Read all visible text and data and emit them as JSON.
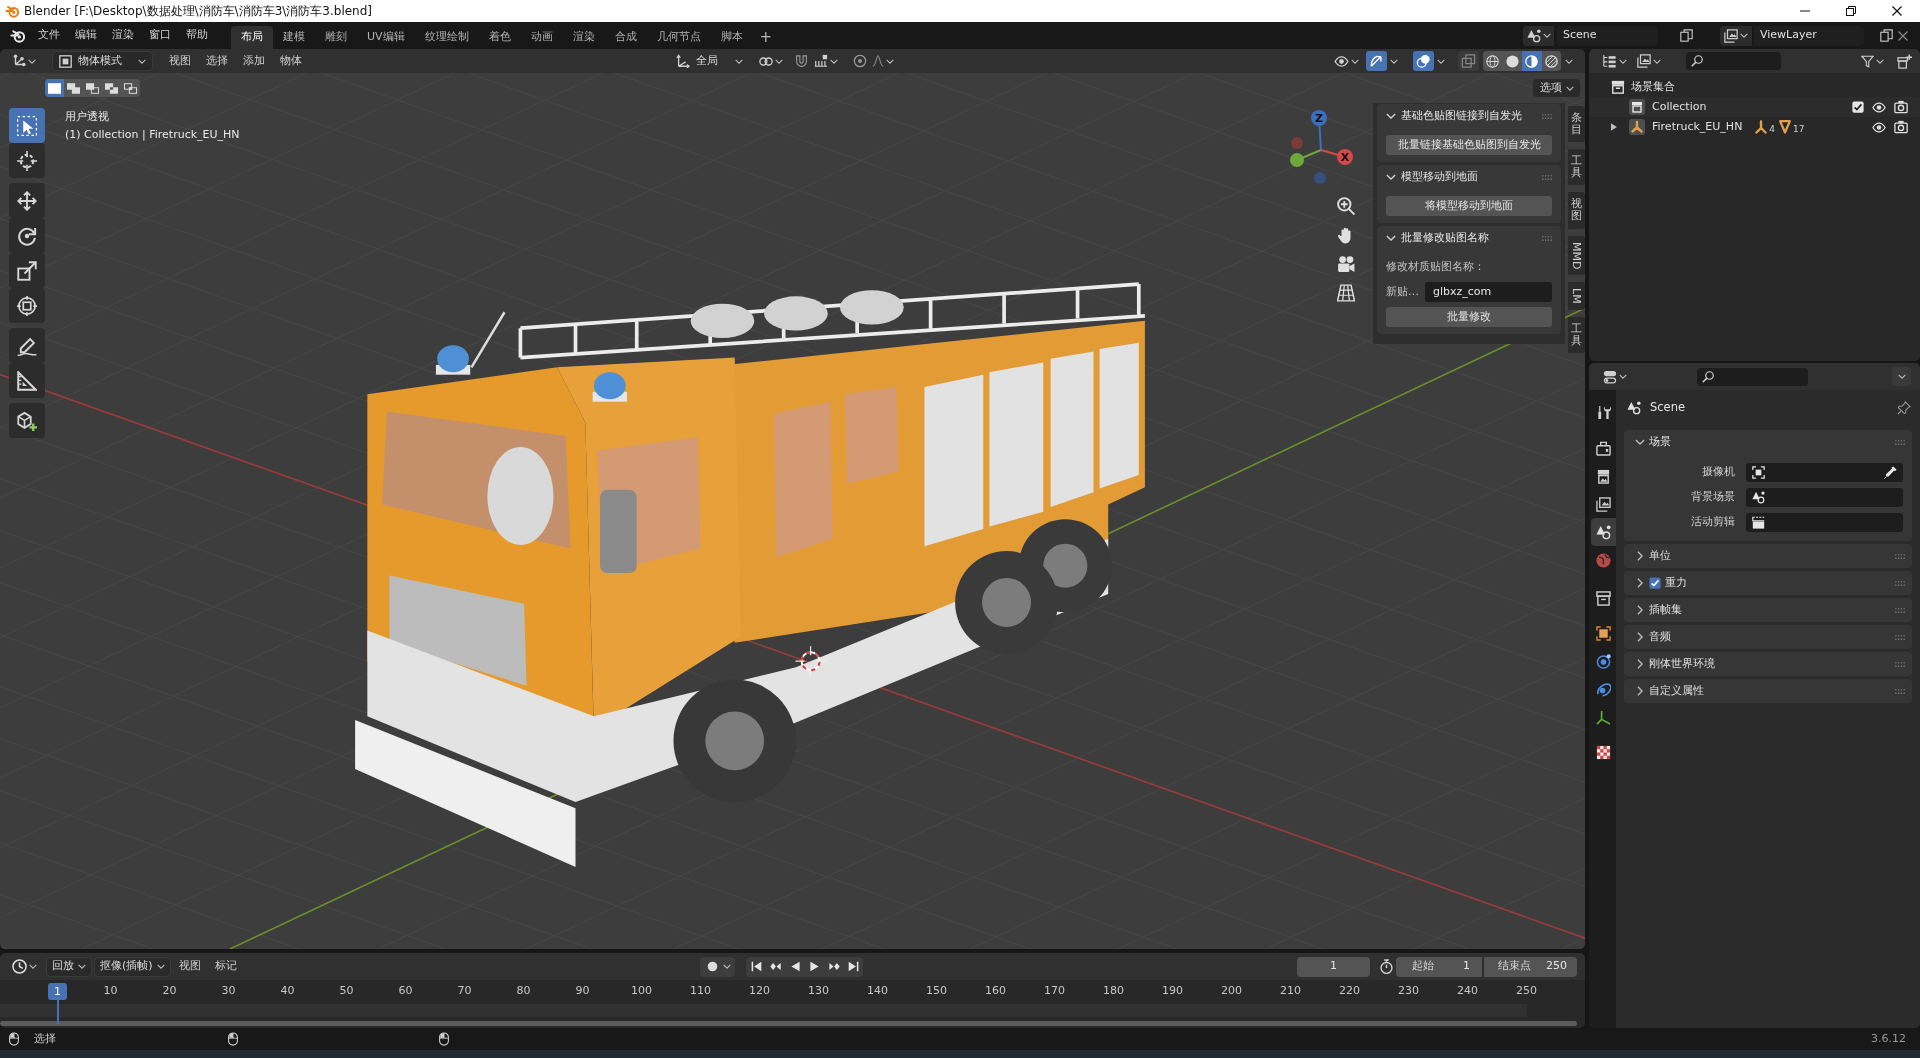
{
  "window": {
    "title": "Blender [F:\\Desktop\\数据处理\\消防车\\消防车3\\消防车3.blend]"
  },
  "menu_bar": {
    "menus": [
      "文件",
      "编辑",
      "渲染",
      "窗口",
      "帮助"
    ],
    "workspaces": [
      {
        "label": "布局",
        "selected": true
      },
      {
        "label": "建模",
        "selected": false
      },
      {
        "label": "雕刻",
        "selected": false
      },
      {
        "label": "UV编辑",
        "selected": false
      },
      {
        "label": "纹理绘制",
        "selected": false
      },
      {
        "label": "着色",
        "selected": false
      },
      {
        "label": "动画",
        "selected": false
      },
      {
        "label": "渲染",
        "selected": false
      },
      {
        "label": "合成",
        "selected": false
      },
      {
        "label": "几何节点",
        "selected": false
      },
      {
        "label": "脚本",
        "selected": false
      }
    ],
    "add_tab": "+",
    "scene": "Scene",
    "view_layer": "ViewLayer"
  },
  "viewport_header": {
    "mode": "物体模式",
    "menus": [
      "视图",
      "选择",
      "添加",
      "物体"
    ],
    "orientation": "全局",
    "toggles": [
      {
        "kind": "gizmo",
        "on": true
      },
      {
        "kind": "overlay",
        "on": true
      },
      {
        "kind": "xray",
        "on": false
      }
    ],
    "shading": [
      {
        "kind": "wireframe",
        "selected": false
      },
      {
        "kind": "solid",
        "selected": false
      },
      {
        "kind": "material",
        "selected": true
      },
      {
        "kind": "rendered",
        "selected": false
      }
    ]
  },
  "tool_settings": {
    "select_modes": [
      {
        "kind": "set",
        "selected": true
      },
      {
        "kind": "extend",
        "selected": false
      },
      {
        "kind": "subtract",
        "selected": false
      },
      {
        "kind": "difference",
        "selected": false
      },
      {
        "kind": "intersect",
        "selected": false
      }
    ],
    "options": "选项"
  },
  "toolbar": [
    {
      "kind": "select",
      "selected": true
    },
    {
      "kind": "cursor",
      "selected": false
    },
    {
      "kind": "move",
      "selected": false
    },
    {
      "kind": "rotate",
      "selected": false
    },
    {
      "kind": "scale",
      "selected": false
    },
    {
      "kind": "transform",
      "selected": false
    },
    {
      "kind": "annotate",
      "selected": false
    },
    {
      "kind": "measure",
      "selected": false
    },
    {
      "kind": "add_cube",
      "selected": false
    }
  ],
  "viewport": {
    "view_name": "用户透视",
    "view_info": "(1) Collection | Firetruck_EU_HN",
    "gizmo_axes": [
      {
        "kind": "z",
        "label": "Z"
      },
      {
        "kind": "x",
        "label": "X"
      }
    ]
  },
  "sidebar": {
    "panels": [
      {
        "title": "基础色贴图链接到自发光",
        "expanded": true,
        "items": [
          {
            "kind": "button",
            "label": "批量链接基础色贴图到自发光"
          }
        ]
      },
      {
        "title": "模型移动到地面",
        "expanded": true,
        "items": [
          {
            "kind": "button",
            "label": "将模型移动到地面"
          }
        ]
      },
      {
        "title": "批量修改贴图名称",
        "expanded": true,
        "items": [
          {
            "kind": "label",
            "text": "修改材质贴图名称："
          },
          {
            "kind": "field",
            "label": "新贴…",
            "value": "glbxz_com"
          },
          {
            "kind": "button",
            "label": "批量修改"
          }
        ]
      }
    ],
    "tabs": [
      "条目",
      "工具",
      "视图",
      "MMD",
      "LM",
      "工具"
    ]
  },
  "outliner": {
    "items": [
      {
        "kind": "scene_collection",
        "label": "场景集合",
        "children": [
          {
            "kind": "collection",
            "label": "Collection",
            "checked": true
          },
          {
            "kind": "object",
            "label": "Firetruck_EU_HN",
            "expanded": false,
            "counts": [
              {
                "kind": "armature",
                "count": "4"
              },
              {
                "kind": "mesh",
                "count": "17"
              }
            ]
          }
        ]
      }
    ]
  },
  "properties": {
    "tabs": [
      {
        "kind": "tool",
        "selected": false
      },
      {
        "kind": "render",
        "selected": false
      },
      {
        "kind": "output",
        "selected": false
      },
      {
        "kind": "view_layer",
        "selected": false
      },
      {
        "kind": "scene",
        "selected": true
      },
      {
        "kind": "world",
        "selected": false
      },
      {
        "kind": "collection",
        "selected": false
      },
      {
        "kind": "object",
        "selected": false
      },
      {
        "kind": "physics",
        "selected": false
      },
      {
        "kind": "constraints",
        "selected": false
      },
      {
        "kind": "data",
        "selected": false
      },
      {
        "kind": "texture",
        "selected": false
      }
    ],
    "context": "Scene",
    "panels": [
      {
        "title": "场景",
        "expanded": true,
        "rows": [
          {
            "kind": "camera",
            "label": "摄像机"
          },
          {
            "kind": "scene",
            "label": "背景场景"
          },
          {
            "kind": "clip",
            "label": "活动剪辑"
          }
        ]
      },
      {
        "title": "单位",
        "expanded": false
      },
      {
        "title": "重力",
        "expanded": false,
        "checked": true
      },
      {
        "title": "插帧集",
        "expanded": false
      },
      {
        "title": "音频",
        "expanded": false
      },
      {
        "title": "刚体世界环境",
        "expanded": false
      },
      {
        "title": "自定义属性",
        "expanded": false
      }
    ]
  },
  "timeline": {
    "menus": [
      {
        "kind": "dropdown",
        "label": "回放"
      },
      {
        "kind": "dropdown",
        "label": "抠像(插帧)"
      },
      {
        "kind": "menu",
        "label": "视图"
      },
      {
        "kind": "menu",
        "label": "标记"
      }
    ],
    "auto_keying": false,
    "current_frame": "1",
    "start_label": "起始",
    "start": "1",
    "end_label": "结束点",
    "end": "250",
    "playhead": "1",
    "ruler": [
      "10",
      "20",
      "30",
      "40",
      "50",
      "60",
      "70",
      "80",
      "90",
      "100",
      "110",
      "120",
      "130",
      "140",
      "150",
      "160",
      "170",
      "180",
      "190",
      "200",
      "210",
      "220",
      "230",
      "240",
      "250"
    ]
  },
  "status_bar": {
    "hint": "选择",
    "version": "3.6.12"
  }
}
